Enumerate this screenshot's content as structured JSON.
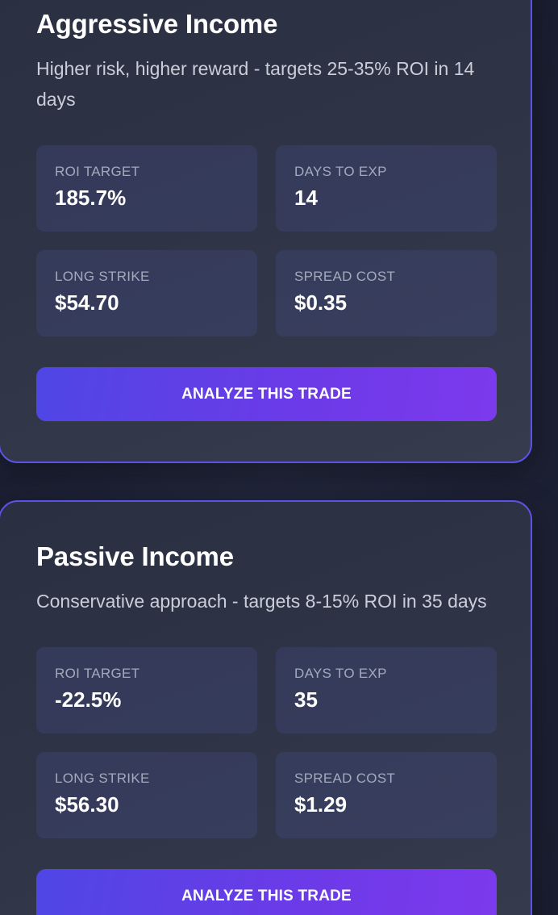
{
  "strategies": [
    {
      "title": "Aggressive Income",
      "description": "Higher risk, higher reward - targets 25-35% ROI in 14 days",
      "stats": {
        "roi_label": "ROI TARGET",
        "roi_value": "185.7%",
        "days_label": "DAYS TO EXP",
        "days_value": "14",
        "strike_label": "LONG STRIKE",
        "strike_value": "$54.70",
        "cost_label": "SPREAD COST",
        "cost_value": "$0.35"
      },
      "button_label": "ANALYZE THIS TRADE"
    },
    {
      "title": "Passive Income",
      "description": "Conservative approach - targets 8-15% ROI in 35 days",
      "stats": {
        "roi_label": "ROI TARGET",
        "roi_value": "-22.5%",
        "days_label": "DAYS TO EXP",
        "days_value": "35",
        "strike_label": "LONG STRIKE",
        "strike_value": "$56.30",
        "cost_label": "SPREAD COST",
        "cost_value": "$1.29"
      },
      "button_label": "ANALYZE THIS TRADE"
    }
  ],
  "colors": {
    "accent_border": "#5b52e6",
    "button_gradient_start": "#4f46e5",
    "button_gradient_end": "#7c3aed"
  }
}
